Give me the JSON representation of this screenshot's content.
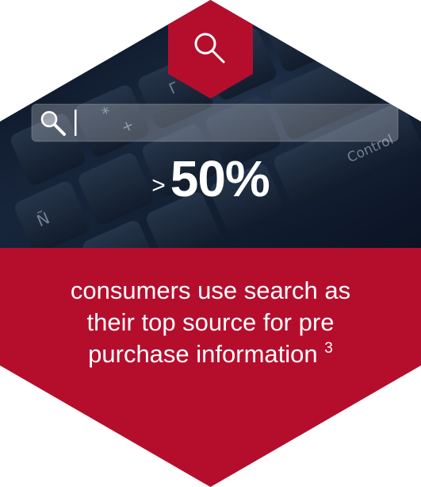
{
  "stat": {
    "prefix": ">",
    "value": "50%"
  },
  "keyboard": {
    "keys": [
      "Ñ",
      "Control",
      "*",
      "+",
      "Γ"
    ]
  },
  "caption": {
    "line1_pre": "consumers use ",
    "line1_em": "search",
    "line1_post": " as",
    "line2_pre": "their top source for ",
    "line2_em": "pre",
    "line3_em": "purchase information",
    "footnote": "3"
  },
  "colors": {
    "brand_red": "#b50e2d",
    "photo_dark": "#0e1a2c",
    "text": "#ffffff"
  },
  "icons": [
    "search-icon",
    "search-icon"
  ]
}
